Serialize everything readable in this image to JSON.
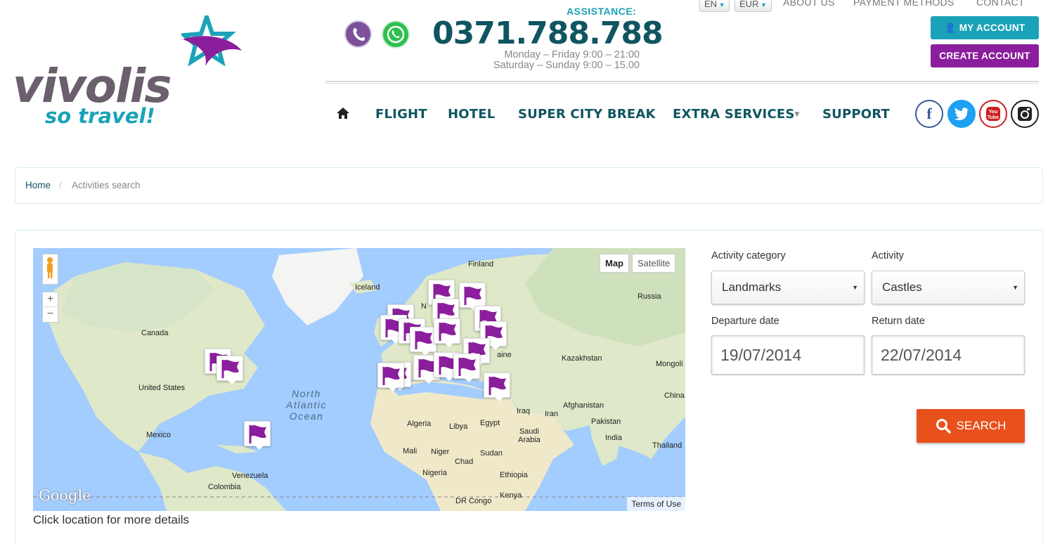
{
  "brand": {
    "name": "vivolis",
    "tagline": "so travel!",
    "colors": {
      "teal": "#1aa3b8",
      "purple": "#8b1e9c",
      "dark_teal": "#0f5561",
      "orange": "#e8501c"
    }
  },
  "contact": {
    "assistance_label": "ASSISTANCE:",
    "phone": "0371.788.788",
    "hours_weekdays": "Monday – Friday 9:00 – 21:00",
    "hours_weekend": "Saturday – Sunday 9:00 – 15.00"
  },
  "top": {
    "language": "EN",
    "currency": "EUR",
    "links": [
      "ABOUT US",
      "PAYMENT METHODS",
      "CONTACT"
    ],
    "my_account": "MY ACCOUNT",
    "create_account": "CREATE ACCOUNT"
  },
  "nav": {
    "items": [
      "FLIGHT",
      "HOTEL",
      "SUPER CITY BREAK",
      "EXTRA SERVICES",
      "SUPPORT"
    ]
  },
  "social": [
    "facebook-icon",
    "twitter-icon",
    "youtube-icon",
    "instagram-icon"
  ],
  "breadcrumb": {
    "home": "Home",
    "sep": "/",
    "current": "Activities search"
  },
  "map": {
    "toggle_map": "Map",
    "toggle_satellite": "Satellite",
    "zoom_in": "+",
    "zoom_out": "−",
    "labels": {
      "finland": "Finland",
      "iceland": "Iceland",
      "russia": "Russia",
      "canada": "Canada",
      "kazakhstan": "Kazakhstan",
      "mongolia": "Mongoli",
      "united_states": "United States",
      "china": "China",
      "afghanistan": "Afghanistan",
      "iraq": "Iraq",
      "iran": "Iran",
      "pakistan": "Pakistan",
      "algeria": "Algeria",
      "libya": "Libya",
      "egypt": "Egypt",
      "saudi": "Saudi\nArabia",
      "india": "India",
      "mexico": "Mexico",
      "thailand": "Thailand",
      "mali": "Mali",
      "niger": "Niger",
      "sudan": "Sudan",
      "chad": "Chad",
      "nigeria": "Nigeria",
      "ethiopia": "Ethiopia",
      "venezuela": "Venezuela",
      "colombia": "Colombia",
      "drcongo": "DR Congo",
      "kenya": "Kenya",
      "n_partial": "N",
      "ukraine_partial": "aine"
    },
    "ocean": "North\nAtlantic\nOcean",
    "google": "Google",
    "terms": "Terms of Use",
    "caption": "Click location for more details"
  },
  "form": {
    "category_label": "Activity category",
    "category_value": "Landmarks",
    "activity_label": "Activity",
    "activity_value": "Castles",
    "departure_label": "Departure date",
    "departure_value": "19/07/2014",
    "return_label": "Return date",
    "return_value": "22/07/2014",
    "search_label": "SEARCH"
  }
}
